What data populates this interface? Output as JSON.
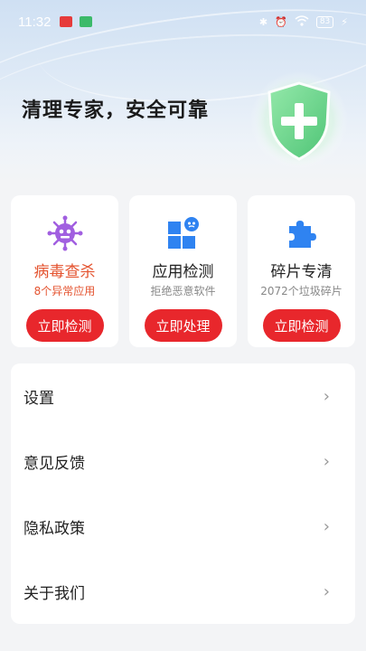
{
  "status_bar": {
    "time": "11:32",
    "battery": "83"
  },
  "hero": {
    "title": "清理专家，安全可靠"
  },
  "cards": [
    {
      "icon": "virus-icon",
      "title": "病毒查杀",
      "subtitle": "8个异常应用",
      "button": "立即检测"
    },
    {
      "icon": "app-grid-icon",
      "title": "应用检测",
      "subtitle": "拒绝恶意软件",
      "button": "立即处理"
    },
    {
      "icon": "puzzle-icon",
      "title": "碎片专清",
      "subtitle": "2072个垃圾碎片",
      "button": "立即检测"
    }
  ],
  "menu": {
    "items": [
      {
        "label": "设置"
      },
      {
        "label": "意见反馈"
      },
      {
        "label": "隐私政策"
      },
      {
        "label": "关于我们"
      }
    ]
  },
  "colors": {
    "accent_red": "#e8272c",
    "alert_orange": "#e4532f",
    "virus_purple": "#a15fe0",
    "blue": "#2f83f1",
    "shield_green": "#5fd47a"
  }
}
